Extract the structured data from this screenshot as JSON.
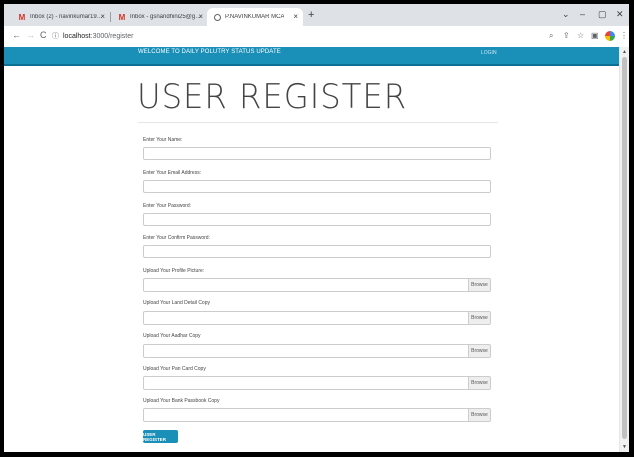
{
  "browser": {
    "tabs": [
      {
        "title": "Inbox (2) - navinkumar1971999@",
        "icon": "gmail-icon",
        "active": false
      },
      {
        "title": "Inbox - gsnandhini25@gmail.co",
        "icon": "gmail-icon",
        "active": false
      },
      {
        "title": "P.NAVINKUMAR MCA",
        "icon": "globe-icon",
        "active": true
      }
    ],
    "new_tab": "+",
    "close_glyph": "×",
    "url_host": "localhost",
    "url_path": ":3000/register",
    "window_controls": {
      "chevron": "⌄",
      "minimize": "–",
      "maximize": "▢",
      "close": "✕"
    },
    "nav": {
      "back": "←",
      "forward": "→",
      "reload": "C"
    },
    "address_icons": {
      "zoom": "⌕",
      "share": "⇪",
      "star": "☆",
      "sidebar": "▣",
      "menu": "⋮"
    }
  },
  "header": {
    "brand": "WELCOME TO DAILY POLUTRY STATUS UPDATE",
    "login": "LOGIN"
  },
  "page_title": "USER REGISTER",
  "form": {
    "name_label": "Enter Your Name:",
    "email_label": "Enter Your Email Address:",
    "password_label": "Enter Your Password:",
    "confirm_label": "Enter Your Confirm Password:",
    "profile_label": "Upload Your Profile Picture:",
    "land_label": "Upload Your Land Detail Copy",
    "aadhar_label": "Upload Your Aadhar Copy",
    "pan_label": "Upload Your Pan Card Copy",
    "bank_label": "Upload Your Bank Passbook Copy",
    "browse": "Browse",
    "submit": "USER REGISTER"
  },
  "colors": {
    "accent": "#1a8fb8",
    "tabstrip": "#dee1e6"
  }
}
